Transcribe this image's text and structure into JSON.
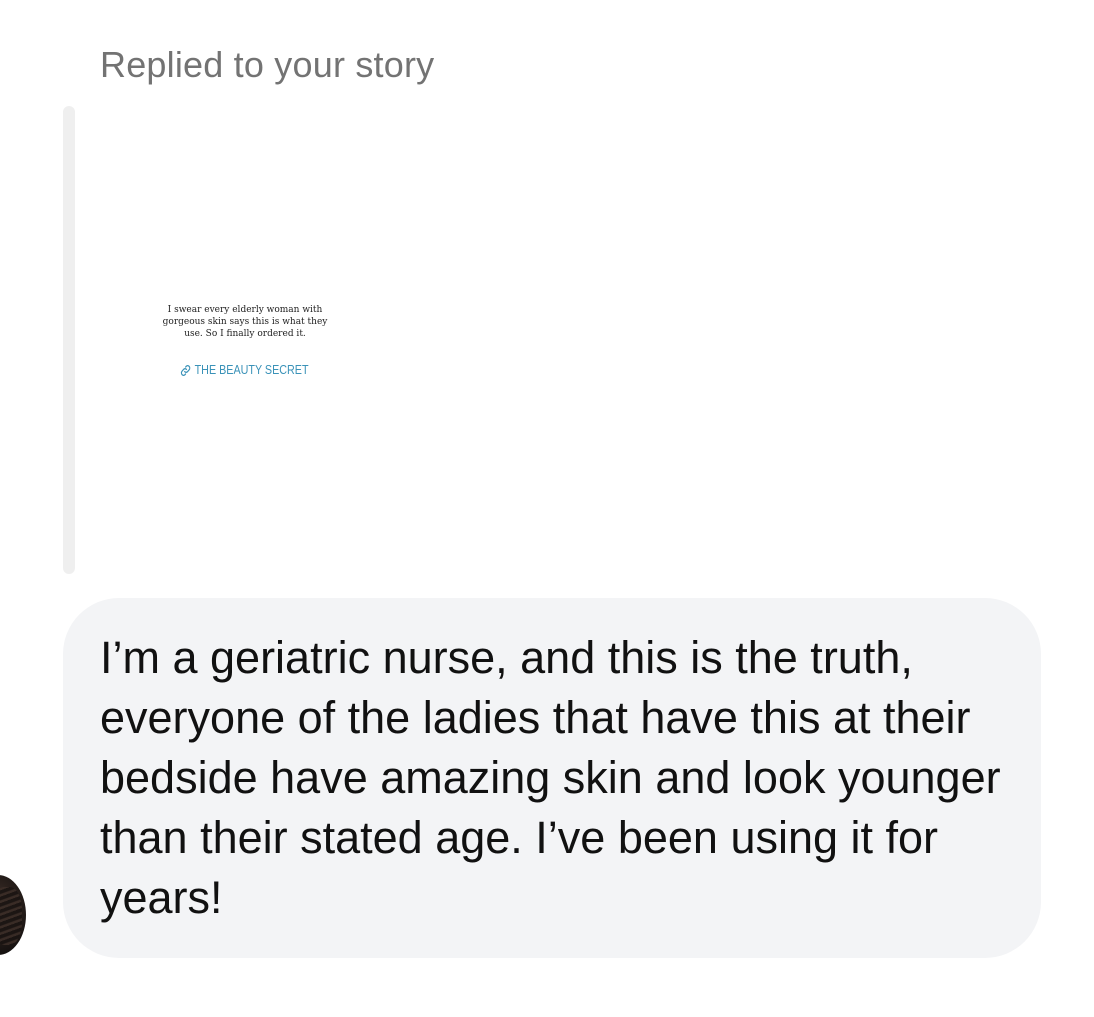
{
  "thread": {
    "reply_label": "Replied to your story"
  },
  "story": {
    "caption": "I swear every elderly woman with gorgeous skin says this is what they use. So I finally ordered it.",
    "link_label": "THE BEAUTY SECRET",
    "link_color": "#3a92b8",
    "link_icon": "link-icon"
  },
  "message": {
    "text": "I’m a geriatric nurse, and this is the truth, everyone of the ladies that have this at their bedside have amazing skin and look younger than their stated age. I’ve been using it for years!",
    "bubble_color": "#f3f4f6"
  },
  "sender": {
    "avatar_icon": "avatar"
  }
}
